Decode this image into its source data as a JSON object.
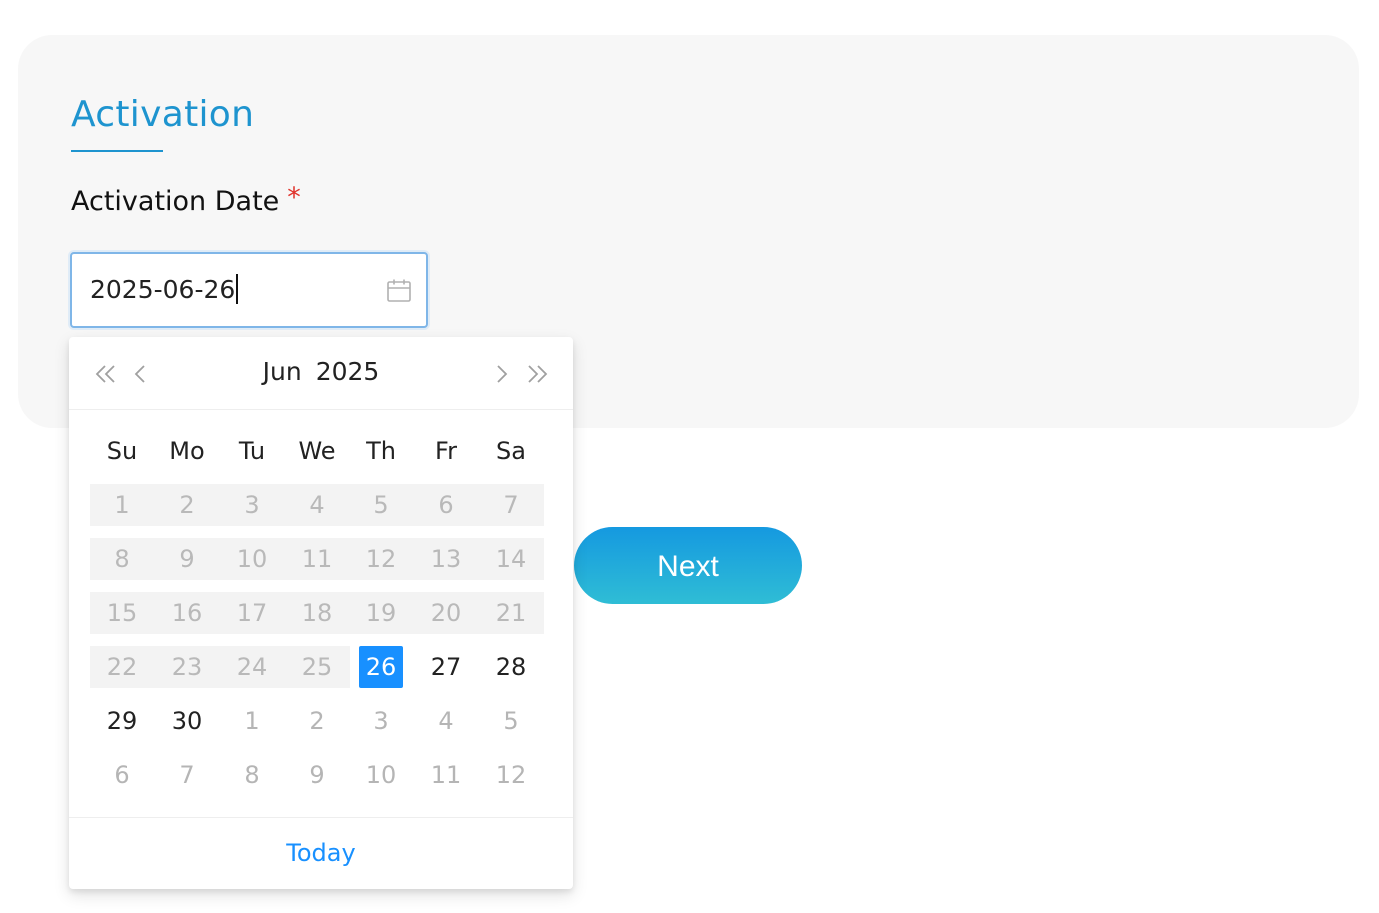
{
  "section": {
    "title": "Activation"
  },
  "field": {
    "label": "Activation Date",
    "required_mark": "*",
    "value": "2025-06-26"
  },
  "buttons": {
    "next_label": "Next"
  },
  "datepicker": {
    "month_label": "Jun",
    "year_label": "2025",
    "weekdays": [
      "Su",
      "Mo",
      "Tu",
      "We",
      "Th",
      "Fr",
      "Sa"
    ],
    "weeks": [
      [
        "1",
        "2",
        "3",
        "4",
        "5",
        "6",
        "7"
      ],
      [
        "8",
        "9",
        "10",
        "11",
        "12",
        "13",
        "14"
      ],
      [
        "15",
        "16",
        "17",
        "18",
        "19",
        "20",
        "21"
      ],
      [
        "22",
        "23",
        "24",
        "25",
        "26",
        "27",
        "28"
      ],
      [
        "29",
        "30",
        "1",
        "2",
        "3",
        "4",
        "5"
      ],
      [
        "6",
        "7",
        "8",
        "9",
        "10",
        "11",
        "12"
      ]
    ],
    "selected_day": "26",
    "today_label": "Today",
    "icons": {
      "super_prev": "double-chevron-left-icon",
      "prev": "chevron-left-icon",
      "next": "chevron-right-icon",
      "super_next": "double-chevron-right-icon",
      "input_icon": "calendar-icon"
    }
  },
  "colors": {
    "accent": "#1e94cf",
    "selected": "#1890ff",
    "required": "#e0322b",
    "button_gradient_top": "#1599e0",
    "button_gradient_bottom": "#2fbdd5"
  }
}
